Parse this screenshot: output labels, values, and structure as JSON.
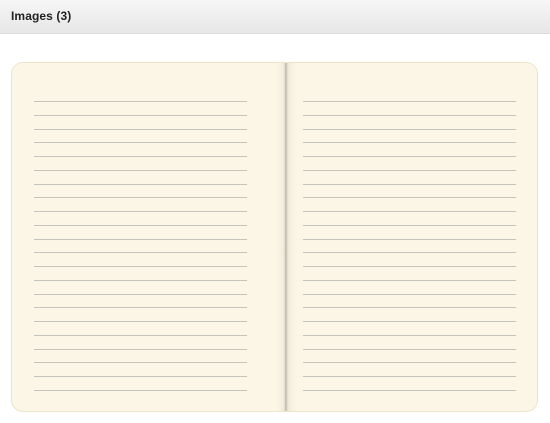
{
  "header": {
    "title": "Images (3)"
  },
  "notebook": {
    "left_page_lines": 22,
    "right_page_lines": 22,
    "paper_color": "#fbf6e5",
    "rule_color": "#c4c4bb"
  }
}
